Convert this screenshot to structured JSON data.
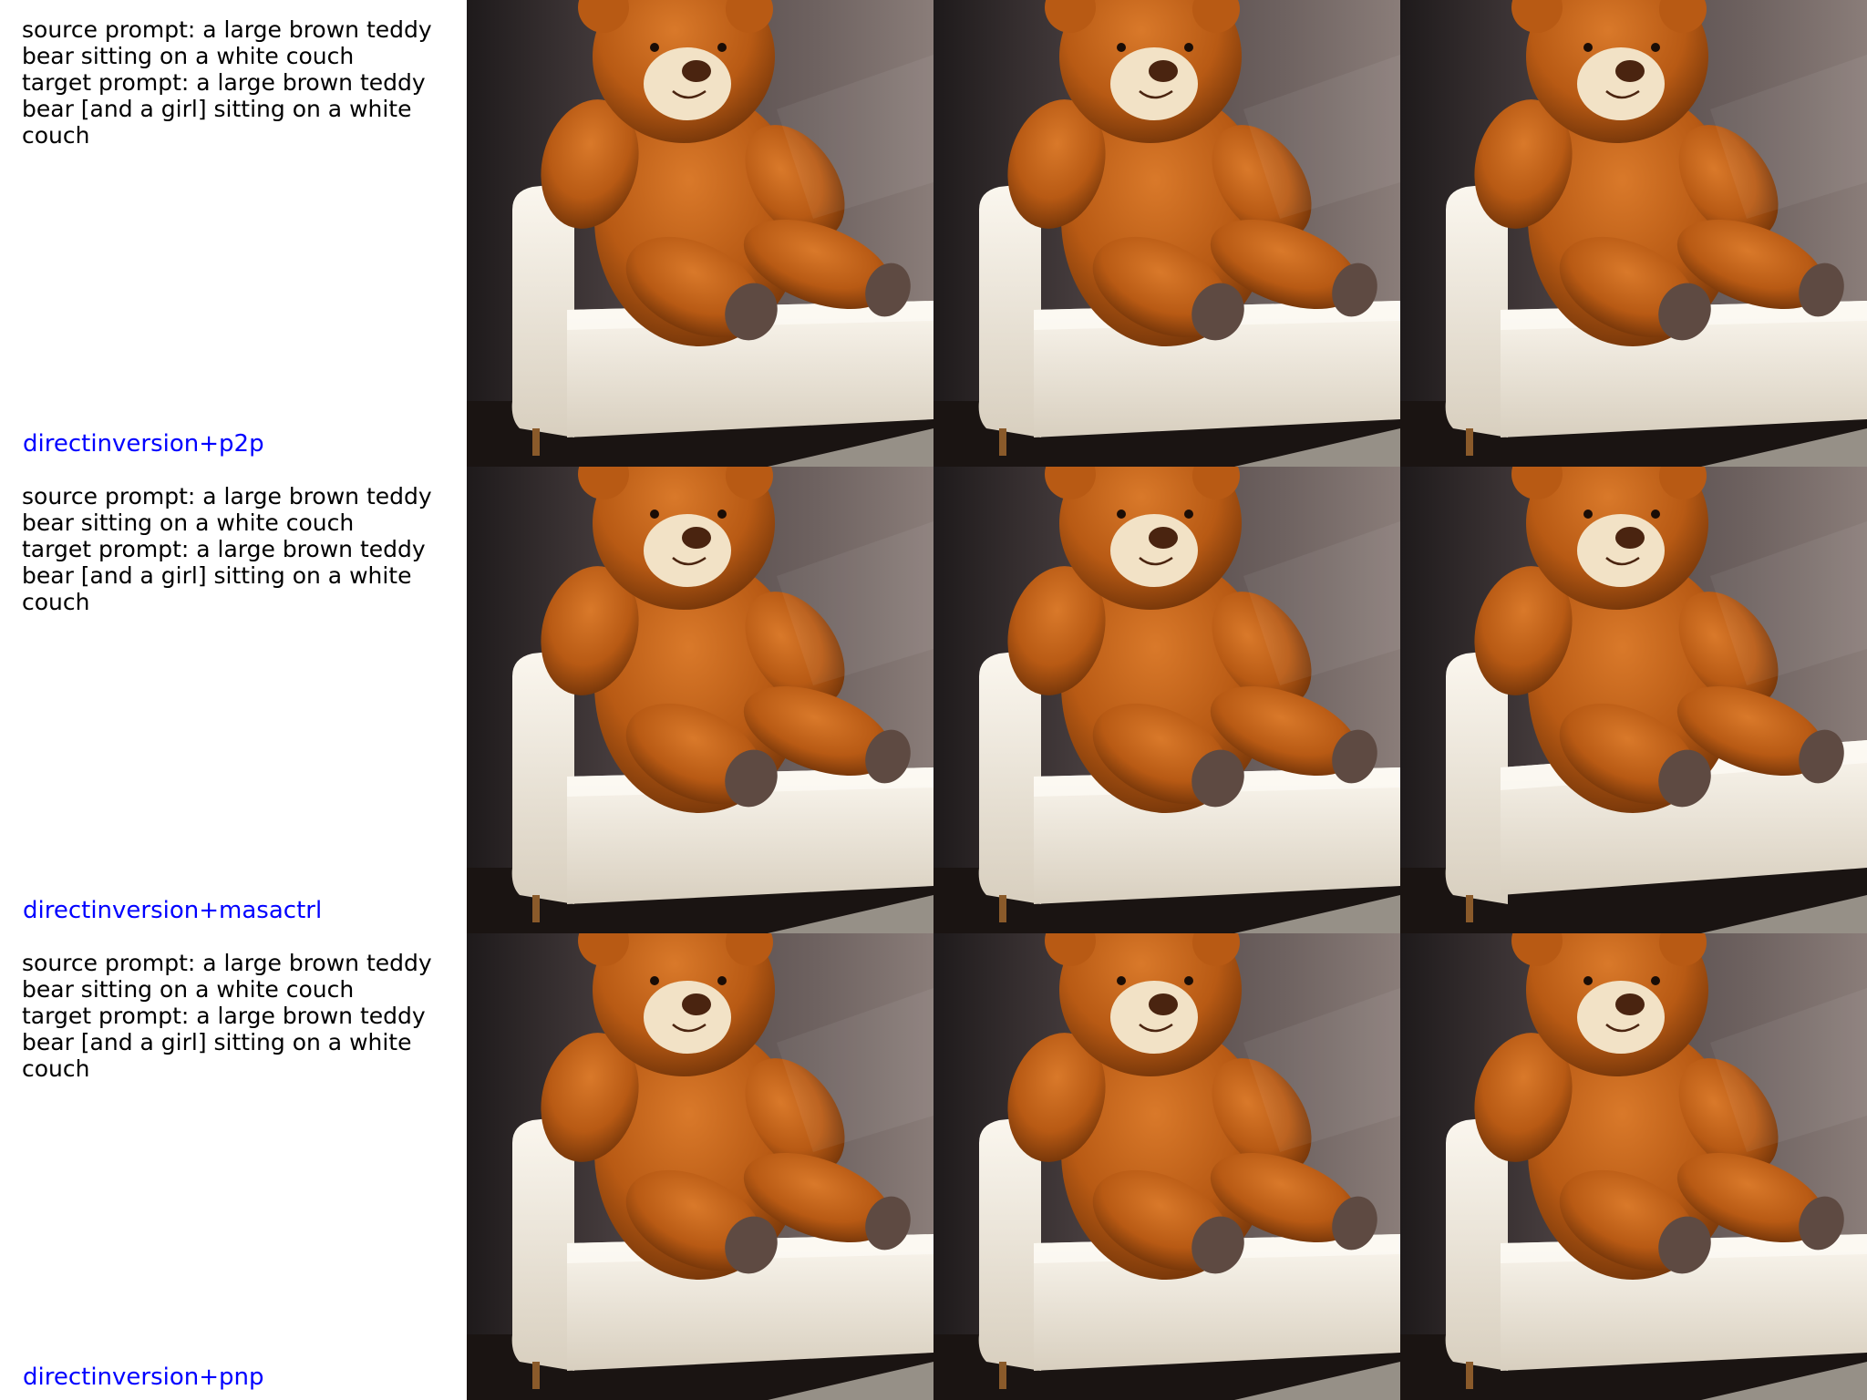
{
  "rows": [
    {
      "source_prompt": "source prompt: a large brown teddy bear sitting on a white couch",
      "target_prompt": "target prompt: a large brown teddy bear [and a girl] sitting on a white couch",
      "method": "directinversion+p2p",
      "images": [
        "source-teddy-bear-photo",
        "edited-teddy-bear-photo",
        "edited-teddy-bear-photo"
      ]
    },
    {
      "source_prompt": "source prompt: a large brown teddy bear sitting on a white couch",
      "target_prompt": "target prompt: a large brown teddy bear [and a girl] sitting on a white couch",
      "method": "directinversion+masactrl",
      "images": [
        "source-teddy-bear-photo",
        "edited-teddy-bear-photo",
        "edited-teddy-bear-photo"
      ]
    },
    {
      "source_prompt": "source prompt: a large brown teddy bear sitting on a white couch",
      "target_prompt": "target prompt: a large brown teddy bear [and a girl] sitting on a white couch",
      "method": "directinversion+pnp",
      "images": [
        "source-teddy-bear-photo",
        "edited-teddy-bear-photo",
        "edited-teddy-bear-photo"
      ]
    }
  ],
  "colors": {
    "method_label": "#0000ff",
    "prompt_text": "#000000",
    "wall": "#6e6260",
    "bear_fur": "#b85a14",
    "couch": "#efe8dc"
  }
}
